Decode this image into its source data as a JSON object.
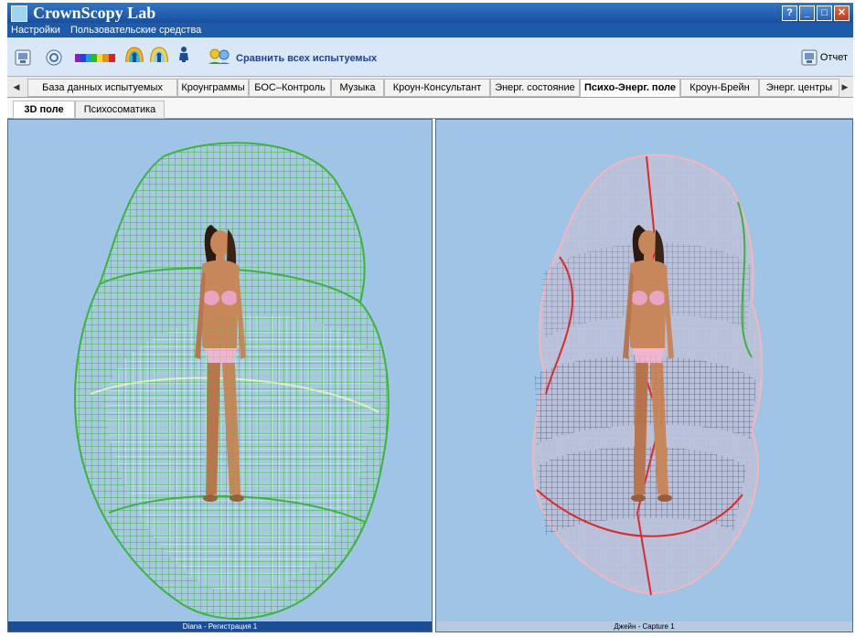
{
  "window": {
    "title": "CrownScopy Lab",
    "help_label": "?",
    "minimize_label": "_",
    "maximize_label": "□",
    "close_label": "✕"
  },
  "menu": {
    "items": [
      "Настройки",
      "Пользовательские средства"
    ]
  },
  "toolbar": {
    "compare_label": "Сравнить всех испытуемых",
    "report_label": "Отчет",
    "icons": [
      "register-icon",
      "history-icon",
      "spectrum-icon",
      "aura-icon",
      "aura-compare-icon",
      "body-icon",
      "users-compare-icon",
      "report-icon"
    ]
  },
  "tabs": {
    "items": [
      "База данных испытуемых",
      "Кроунграммы",
      "БОС–Контроль",
      "Музыка",
      "Кроун-Консультант",
      "Энерг. состояние",
      "Психо-Энерг. поле",
      "Кроун-Брейн",
      "Энерг. центры"
    ],
    "active": "Психо-Энерг. поле"
  },
  "subtabs": {
    "items": [
      "3D поле",
      "Психосоматика"
    ],
    "active": "3D поле"
  },
  "panels": {
    "left_caption": "Diana  - Регистрация 1",
    "right_caption": "Джейн  - Capture 1"
  },
  "colors": {
    "titlebar": "#1f5eb0",
    "menubar": "#1d5aa9",
    "toolbar": "#d9e7f7",
    "viewport_bg": "#a0c4e6",
    "field_green": "#3cb33c",
    "field_red": "#e02828",
    "field_pink": "#f4b6bd",
    "skin": "#c8875a"
  }
}
